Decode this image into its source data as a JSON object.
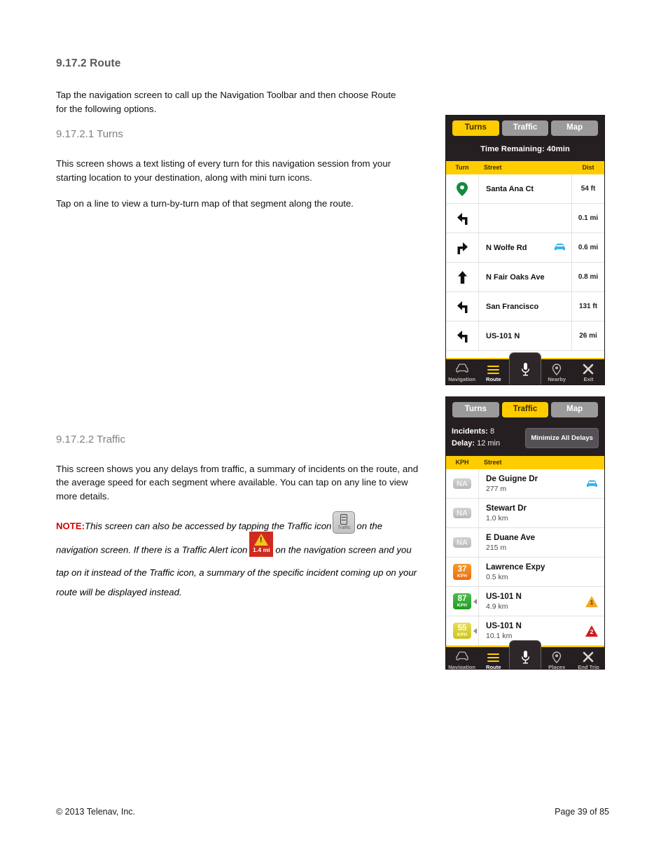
{
  "document": {
    "section_title": "9.17.2 Route",
    "intro": "Tap the navigation screen to call up the Navigation Toolbar and then choose Route for the following options.",
    "turns": {
      "sub_title": "9.17.2.1 Turns",
      "para1": "This screen shows a text listing of every turn for this navigation session from your starting location to your destination, along with mini turn icons.",
      "para2": "Tap on a line to view a turn-by-turn map of that segment along the route."
    },
    "traffic": {
      "sub_title": "9.17.2.2 Traffic",
      "para1": "This screen shows you any delays from traffic, a summary of incidents on the route, and the average speed for each segment where available. You can tap on any line to view more details.",
      "note_label": "NOTE:",
      "note_part1": "This screen can also be accessed by tapping the Traffic icon",
      "note_part2": "on the navigation screen. If there is a Traffic Alert icon",
      "note_part3": "on the navigation screen and you tap on it instead of the Traffic icon, a summary of the specific incident coming up on your route will be displayed instead.",
      "inline_traffic_icon_label": "Traffic",
      "inline_alert_icon_label": "1.4 mi"
    }
  },
  "footer": {
    "copyright": "© 2013 Telenav, Inc.",
    "page": "Page 39 of 85"
  },
  "colors": {
    "accent_yellow": "#ffcc00",
    "dark_chrome": "#251f22",
    "segment_inactive": "#9a9a9a",
    "note_red": "#d40000",
    "car_blue": "#2fb5e8",
    "speed_green": "#1d9a20",
    "speed_orange": "#ef6c0c",
    "speed_yellow": "#cdc41d",
    "warn_orange": "#f5a623",
    "warn_red": "#cf1b1b"
  },
  "turns_screen": {
    "segments": [
      {
        "label": "Turns",
        "active": true
      },
      {
        "label": "Traffic",
        "active": false
      },
      {
        "label": "Map",
        "active": false
      }
    ],
    "time_remaining": "Time Remaining: 40min",
    "columns": {
      "turn": "Turn",
      "street": "Street",
      "dist": "Dist"
    },
    "rows": [
      {
        "icon": "map-pin-icon",
        "street": "Santa Ana Ct",
        "dist": "54 ft",
        "has_car": false
      },
      {
        "icon": "turn-left-icon",
        "street": "",
        "dist": "0.1 mi",
        "has_car": false
      },
      {
        "icon": "turn-right-icon",
        "street": "N Wolfe Rd",
        "dist": "0.6 mi",
        "has_car": true
      },
      {
        "icon": "arrow-straight-icon",
        "street": "N Fair Oaks Ave",
        "dist": "0.8 mi",
        "has_car": false
      },
      {
        "icon": "turn-left-icon",
        "street": "San Francisco",
        "dist": "131 ft",
        "has_car": false
      },
      {
        "icon": "turn-left-icon",
        "street": "US-101 N",
        "dist": "26 mi",
        "has_car": false
      }
    ],
    "toolbar": [
      {
        "label": "Navigation",
        "icon": "car-icon",
        "active": false
      },
      {
        "label": "Route",
        "icon": "list-icon",
        "active": true
      },
      {
        "label": "",
        "icon": "microphone-icon",
        "active": false
      },
      {
        "label": "Nearby",
        "icon": "place-pin-icon",
        "active": false
      },
      {
        "label": "Exit",
        "icon": "close-x-icon",
        "active": false
      }
    ]
  },
  "traffic_screen": {
    "segments": [
      {
        "label": "Turns",
        "active": false
      },
      {
        "label": "Traffic",
        "active": true
      },
      {
        "label": "Map",
        "active": false
      }
    ],
    "stats": {
      "incidents_label": "Incidents:",
      "incidents_value": "8",
      "delay_label": "Delay:",
      "delay_value": "12 min",
      "minimize_button": "Minimize All Delays"
    },
    "columns": {
      "kph": "KPH",
      "street": "Street"
    },
    "rows": [
      {
        "speed": "NA",
        "unit": "",
        "style": "na",
        "street": "De Guigne Dr",
        "distance": "277 m",
        "has_car": true,
        "has_arrow": false,
        "warn": null
      },
      {
        "speed": "NA",
        "unit": "",
        "style": "na",
        "street": "Stewart Dr",
        "distance": "1.0 km",
        "has_car": false,
        "has_arrow": false,
        "warn": null
      },
      {
        "speed": "NA",
        "unit": "",
        "style": "na",
        "street": "E Duane Ave",
        "distance": "215 m",
        "has_car": false,
        "has_arrow": false,
        "warn": null
      },
      {
        "speed": "37",
        "unit": "KPH",
        "style": "orange",
        "street": "Lawrence Expy",
        "distance": "0.5 km",
        "has_car": false,
        "has_arrow": false,
        "warn": null
      },
      {
        "speed": "87",
        "unit": "KPH",
        "style": "green",
        "street": "US-101 N",
        "distance": "4.9 km",
        "has_car": false,
        "has_arrow": true,
        "warn": {
          "count": "1",
          "color": "orange"
        }
      },
      {
        "speed": "55",
        "unit": "KPH",
        "style": "yellow",
        "street": "US-101 N",
        "distance": "10.1 km",
        "has_car": false,
        "has_arrow": true,
        "warn": {
          "count": "2",
          "color": "red"
        }
      }
    ],
    "toolbar": [
      {
        "label": "Navigation",
        "icon": "car-icon",
        "active": false
      },
      {
        "label": "Route",
        "icon": "list-icon",
        "active": true
      },
      {
        "label": "",
        "icon": "microphone-icon",
        "active": false
      },
      {
        "label": "Places",
        "icon": "place-pin-icon",
        "active": false
      },
      {
        "label": "End Trip",
        "icon": "close-x-icon",
        "active": false
      }
    ]
  }
}
